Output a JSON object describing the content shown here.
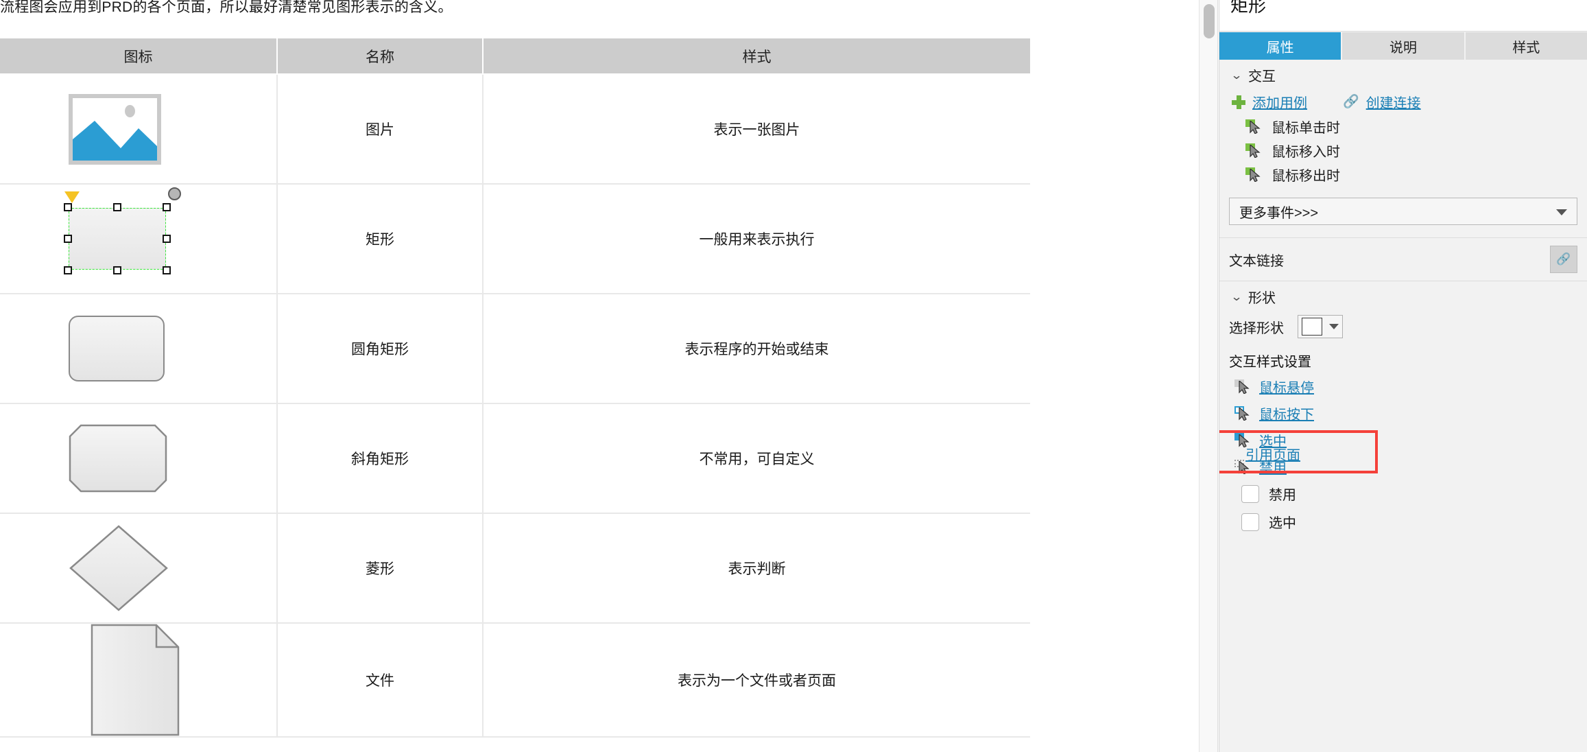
{
  "document": {
    "intro_paragraph": "流程图会应用到PRD的各个页面，所以最好清楚常见图形表示的含义。",
    "table": {
      "headers": [
        "图标",
        "名称",
        "样式"
      ],
      "rows": [
        {
          "icon": "picture-icon",
          "name": "图片",
          "style": "表示一张图片"
        },
        {
          "icon": "rectangle-selected",
          "name": "矩形",
          "style": "一般用来表示执行"
        },
        {
          "icon": "rounded-rectangle",
          "name": "圆角矩形",
          "style": "表示程序的开始或结束"
        },
        {
          "icon": "octagon-rectangle",
          "name": "斜角矩形",
          "style": "不常用，可自定义"
        },
        {
          "icon": "diamond",
          "name": "菱形",
          "style": "表示判断"
        },
        {
          "icon": "document-shape",
          "name": "文件",
          "style": "表示为一个文件或者页面"
        }
      ]
    }
  },
  "panel": {
    "title": "矩形",
    "tabs": [
      {
        "label": "属性",
        "active": true
      },
      {
        "label": "说明",
        "active": false
      },
      {
        "label": "样式",
        "active": false
      }
    ],
    "interaction_section": {
      "header": "交互",
      "add_case_label": "添加用例",
      "create_link_label": "创建连接",
      "events": [
        "鼠标单击时",
        "鼠标移入时",
        "鼠标移出时"
      ],
      "more_events_label": "更多事件>>>"
    },
    "text_link": {
      "label": "文本链接"
    },
    "shape_section": {
      "header": "形状",
      "select_shape_label": "选择形状",
      "interaction_style_title": "交互样式设置",
      "style_states": [
        "鼠标悬停",
        "鼠标按下",
        "选中",
        "禁用"
      ],
      "reference_page_label": "引用页面",
      "checkboxes": [
        {
          "label": "禁用",
          "checked": false
        },
        {
          "label": "选中",
          "checked": false
        }
      ]
    }
  },
  "colors": {
    "accent_blue": "#2b9dd3",
    "link_blue": "#1b7fb5",
    "green_plus": "#6db33f",
    "highlight_red": "#f4413a",
    "header_gray": "#cccccc",
    "panel_bg": "#f2f2f2",
    "handle_yellow": "#f5c324",
    "selection_green": "#3ce83c"
  }
}
